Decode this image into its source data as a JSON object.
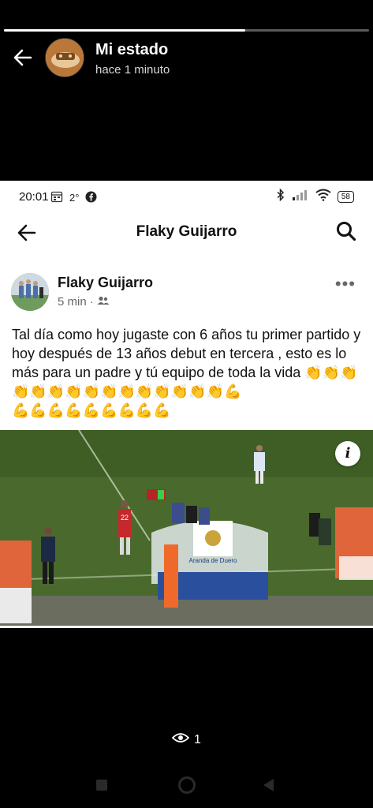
{
  "story": {
    "title": "Mi estado",
    "time": "hace 1 minuto",
    "progress": 0.66,
    "viewers_count": "1"
  },
  "embedded": {
    "status_bar": {
      "time": "20:01",
      "temp": "2°",
      "battery": "58"
    },
    "header": {
      "title": "Flaky Guijarro"
    },
    "post": {
      "author": "Flaky Guijarro",
      "time": "5 min",
      "audience_icon": "friends-icon",
      "text": "Tal día como hoy jugaste con 6 años tu primer partido y hoy después de 13 años debut en tercera , esto es lo más para un padre y tú equipo de toda la vida",
      "emoji_line1": "👏👏👏👏👏👏👏👏👏👏👏👏👏👏👏💪",
      "emoji_line2": "💪💪💪💪💪💪💪💪💪",
      "photo_signage": "Aranda de Duero",
      "photo_board_number": "22"
    }
  },
  "colors": {
    "story_bg": "#000000",
    "fb_text": "#050505",
    "fb_secondary": "#65676b"
  }
}
